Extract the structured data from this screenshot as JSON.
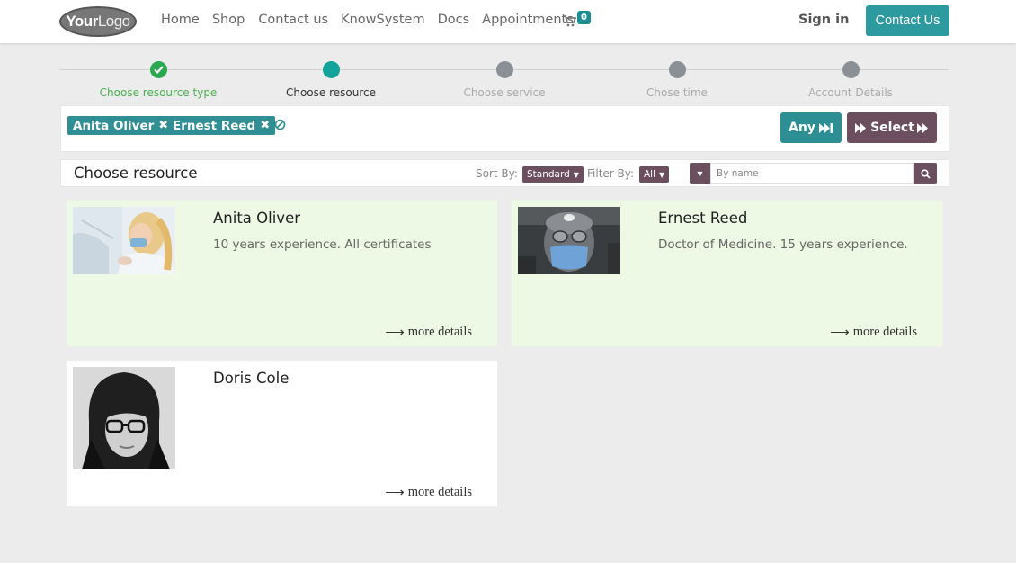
{
  "navbar": {
    "logo_bold": "Your",
    "logo_rest": "Logo",
    "links": [
      "Home",
      "Shop",
      "Contact us",
      "KnowSystem",
      "Docs",
      "Appointments"
    ],
    "cart_count": "0",
    "sign_in": "Sign in",
    "contact_button": "Contact Us"
  },
  "steps": [
    {
      "label": "Choose resource type",
      "state": "done"
    },
    {
      "label": "Choose resource",
      "state": "active"
    },
    {
      "label": "Choose service",
      "state": "pending"
    },
    {
      "label": "Chose time",
      "state": "pending"
    },
    {
      "label": "Account Details",
      "state": "pending"
    }
  ],
  "selected": {
    "tags": [
      "Anita Oliver",
      "Ernest Reed"
    ],
    "any_label": "Any",
    "select_label": "Select"
  },
  "toolbar": {
    "title": "Choose resource",
    "sort_label": "Sort By:",
    "sort_value": "Standard",
    "filter_label": "Filter By:",
    "filter_value": "All",
    "search_placeholder": "By name"
  },
  "resources": [
    {
      "name": "Anita Oliver",
      "description": "10 years experience. All certificates",
      "more": "more details",
      "selected": true
    },
    {
      "name": "Ernest Reed",
      "description": "Doctor of Medicine. 15 years experience.",
      "more": "more details",
      "selected": true
    },
    {
      "name": "Doris Cole",
      "description": "",
      "more": "more details",
      "selected": false
    }
  ],
  "colors": {
    "accent_teal": "#2d9a9f",
    "accent_purple": "#6b4f5f",
    "selected_card": "#eef9e5",
    "done_green": "#2aa84f"
  }
}
